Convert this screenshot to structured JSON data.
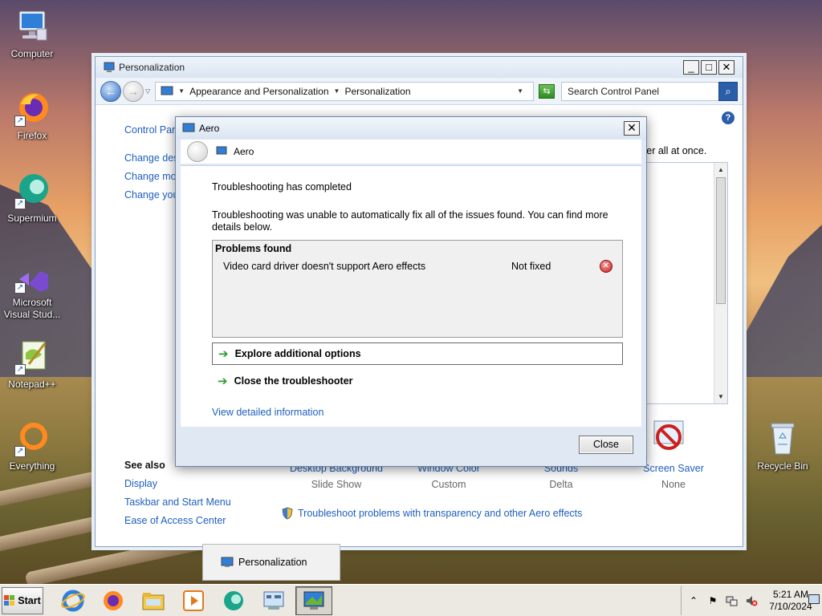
{
  "desktop": {
    "icons": [
      {
        "label": "Computer"
      },
      {
        "label": "Firefox"
      },
      {
        "label": "Supermium"
      },
      {
        "label": "Microsoft Visual Stud..."
      },
      {
        "label": "Notepad++"
      },
      {
        "label": "Everything"
      },
      {
        "label": "Recycle Bin"
      }
    ]
  },
  "window": {
    "title": "Personalization",
    "address": {
      "crumb1": "Appearance and Personalization",
      "crumb2": "Personalization"
    },
    "search_placeholder": "Search Control Panel",
    "left_links": {
      "home": "Control Pan",
      "l1": "Change des",
      "l2": "Change mo",
      "l3": "Change you"
    },
    "right_text": "ver all at once.",
    "see_also": {
      "header": "See also",
      "items": [
        "Display",
        "Taskbar and Start Menu",
        "Ease of Access Center"
      ]
    },
    "bottom_items": [
      {
        "label": "Desktop Background",
        "sub": "Slide Show"
      },
      {
        "label": "Window Color",
        "sub": "Custom"
      },
      {
        "label": "Sounds",
        "sub": "Delta"
      },
      {
        "label": "Screen Saver",
        "sub": "None"
      }
    ],
    "troubleshoot_link": "Troubleshoot problems with transparency and other Aero effects"
  },
  "dialog": {
    "title": "Aero",
    "nav_title": "Aero",
    "heading": "Troubleshooting has completed",
    "message": "Troubleshooting was unable to automatically fix all of the issues found. You can find more details below.",
    "problems_header": "Problems found",
    "problem": {
      "name": "Video card driver doesn't support Aero effects",
      "status": "Not fixed"
    },
    "option1": "Explore additional options",
    "option2": "Close the troubleshooter",
    "detail_link": "View detailed information",
    "close_label": "Close"
  },
  "thumbnail": {
    "label": "Personalization"
  },
  "taskbar": {
    "start_label": "Start",
    "clock_time": "5:21 AM",
    "clock_date": "7/10/2024"
  },
  "colors": {
    "link": "#1e5fbf",
    "accent": "#2a5ea8"
  }
}
